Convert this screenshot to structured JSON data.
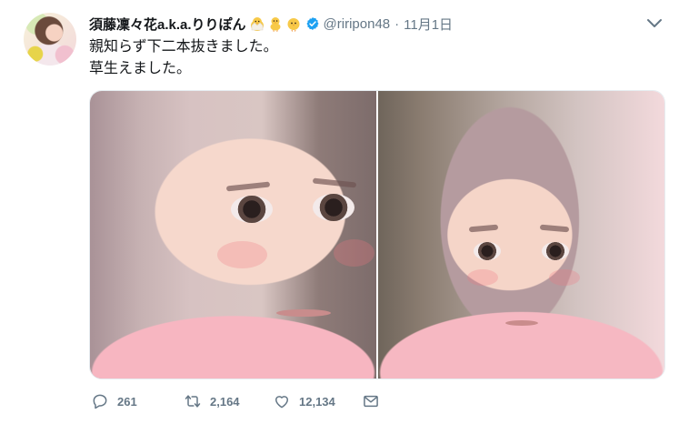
{
  "tweet": {
    "user": {
      "display_name": "須藤凜々花a.k.a.りりぽん",
      "emojis": [
        "baby-chick-emoji",
        "front-facing-baby-chick-emoji",
        "baby-chick-emoji"
      ],
      "handle": "@riripon48",
      "verified": true
    },
    "separator": "·",
    "date": "11月1日",
    "text_lines": [
      "親知らず下二本抜きました。",
      "草生えました。"
    ],
    "media": {
      "images": [
        "before-photo",
        "after-photo"
      ]
    },
    "actions": {
      "replies": "261",
      "retweets": "2,164",
      "likes": "12,134"
    }
  },
  "colors": {
    "text": "#14171a",
    "secondary": "#657786",
    "verified": "#1da1f2",
    "chick": "#f7c948"
  }
}
